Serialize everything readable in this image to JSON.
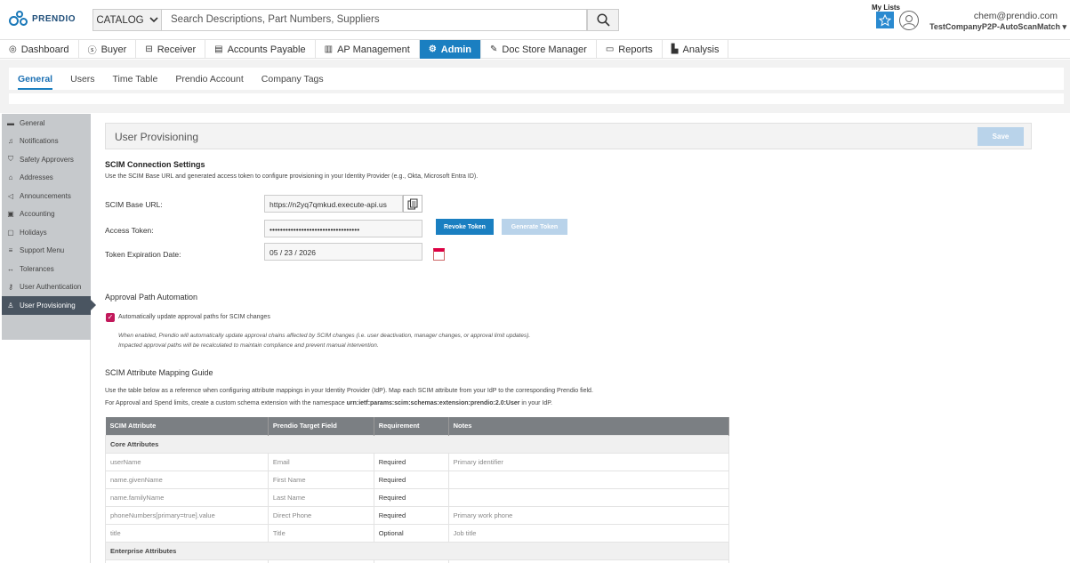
{
  "header": {
    "logo_text": "PRENDIO",
    "catalog_label": "CATALOG",
    "search_placeholder": "Search Descriptions, Part Numbers, Suppliers",
    "my_lists_label": "My Lists",
    "user_email": "chem@prendio.com",
    "user_company": "TestCompanyP2P-AutoScanMatch"
  },
  "nav": {
    "items": [
      {
        "label": "Dashboard",
        "icon": "dashboard-icon"
      },
      {
        "label": "Buyer",
        "icon": "dollar-icon"
      },
      {
        "label": "Receiver",
        "icon": "box-icon"
      },
      {
        "label": "Accounts Payable",
        "icon": "invoice-icon"
      },
      {
        "label": "AP Management",
        "icon": "document-icon"
      },
      {
        "label": "Admin",
        "icon": "gear-icon"
      },
      {
        "label": "Doc Store Manager",
        "icon": "pen-icon"
      },
      {
        "label": "Reports",
        "icon": "report-icon"
      },
      {
        "label": "Analysis",
        "icon": "chart-icon"
      }
    ],
    "active": "Admin"
  },
  "subtabs": {
    "items": [
      "General",
      "Users",
      "Time Table",
      "Prendio Account",
      "Company Tags"
    ],
    "active": "General"
  },
  "sidebar": {
    "items": [
      {
        "label": "General",
        "icon": "building-icon"
      },
      {
        "label": "Notifications",
        "icon": "bell-icon"
      },
      {
        "label": "Safety Approvers",
        "icon": "shield-icon"
      },
      {
        "label": "Addresses",
        "icon": "home-icon"
      },
      {
        "label": "Announcements",
        "icon": "megaphone-icon"
      },
      {
        "label": "Accounting",
        "icon": "ledger-icon"
      },
      {
        "label": "Holidays",
        "icon": "calendar-icon"
      },
      {
        "label": "Support Menu",
        "icon": "menu-icon"
      },
      {
        "label": "Tolerances",
        "icon": "tolerance-icon"
      },
      {
        "label": "User Authentication",
        "icon": "key-icon"
      },
      {
        "label": "User Provisioning",
        "icon": "user-provision-icon"
      }
    ],
    "active": "User Provisioning"
  },
  "panel": {
    "title": "User Provisioning",
    "save_label": "Save"
  },
  "scim": {
    "title": "SCIM Connection Settings",
    "description": "Use the SCIM Base URL and generated access token to configure provisioning in your Identity Provider (e.g., Okta, Microsoft Entra ID).",
    "base_url_label": "SCIM Base URL:",
    "base_url_value": "https://n2yq7qmkud.execute-api.us",
    "access_token_label": "Access Token:",
    "access_token_value": "••••••••••••••••••••••••••••••••••",
    "revoke_label": "Revoke Token",
    "generate_label": "Generate Token",
    "expiration_label": "Token Expiration Date:",
    "expiration_value": "05 / 23 / 2026"
  },
  "approval": {
    "title": "Approval Path Automation",
    "checkbox_label": "Automatically update approval paths for SCIM changes",
    "checked": true,
    "note_line1": "When enabled, Prendio will automatically update approval chains affected by SCIM changes (i.e. user deactivation, manager changes, or approval limit updates).",
    "note_line2": "Impacted approval paths will be recalculated to maintain compliance and prevent manual intervention."
  },
  "mapping": {
    "title": "SCIM Attribute Mapping Guide",
    "desc_line1": "Use the table below as a reference when configuring attribute mappings in your Identity Provider (IdP). Map each SCIM attribute from your IdP to the corresponding Prendio field.",
    "desc_line2_prefix": "For Approval and Spend limits, create a custom schema extension with the namespace ",
    "desc_line2_namespace": "urn:ietf:params:scim:schemas:extension:prendio:2.0:User",
    "desc_line2_suffix": " in your IdP.",
    "columns": [
      "SCIM Attribute",
      "Prendio Target Field",
      "Requirement",
      "Notes"
    ],
    "groups": [
      {
        "name": "Core Attributes",
        "rows": [
          [
            "userName",
            "Email",
            "Required",
            "Primary identifier"
          ],
          [
            "name.givenName",
            "First Name",
            "Required",
            ""
          ],
          [
            "name.familyName",
            "Last Name",
            "Required",
            ""
          ],
          [
            "phoneNumbers[primary=true].value",
            "Direct Phone",
            "Required",
            "Primary work phone"
          ],
          [
            "title",
            "Title",
            "Optional",
            "Job title"
          ]
        ]
      },
      {
        "name": "Enterprise Attributes",
        "rows": []
      }
    ]
  }
}
